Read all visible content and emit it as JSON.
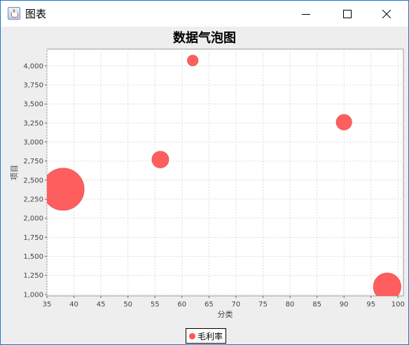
{
  "window": {
    "title": "图表",
    "icon": "java-cup-icon",
    "controls": [
      "minimize-icon",
      "maximize-icon",
      "close-icon"
    ]
  },
  "colors": {
    "bubble": "#ff5555",
    "plot_background": "#ffffff",
    "grid": "#dddddd",
    "frame": "#1979ca"
  },
  "chart_data": {
    "type": "scatter",
    "subtype": "bubble",
    "title": "数据气泡图",
    "xlabel": "分类",
    "ylabel": "项目",
    "xlim": [
      35,
      101
    ],
    "ylim": [
      980,
      4220
    ],
    "x_ticks": [
      35,
      40,
      45,
      50,
      55,
      60,
      65,
      70,
      75,
      80,
      85,
      90,
      95,
      100
    ],
    "y_ticks": [
      1000,
      1250,
      1500,
      1750,
      2000,
      2250,
      2500,
      2750,
      3000,
      3250,
      3500,
      3750,
      4000
    ],
    "x_tick_labels": [
      "35",
      "40",
      "45",
      "50",
      "55",
      "60",
      "65",
      "70",
      "75",
      "80",
      "85",
      "90",
      "95",
      "100"
    ],
    "y_tick_labels": [
      "1,000",
      "1,250",
      "1,500",
      "1,750",
      "2,000",
      "2,250",
      "2,500",
      "2,750",
      "3,000",
      "3,250",
      "3,500",
      "3,750",
      "4,000"
    ],
    "grid": true,
    "legend_position": "bottom",
    "series": [
      {
        "name": "毛利率",
        "color": "#ff5555",
        "points": [
          {
            "x": 38,
            "y": 2380,
            "size": 3.5
          },
          {
            "x": 56,
            "y": 2770,
            "size": 1.4
          },
          {
            "x": 62,
            "y": 4070,
            "size": 0.9
          },
          {
            "x": 90,
            "y": 3260,
            "size": 1.3
          },
          {
            "x": 98,
            "y": 1100,
            "size": 2.3
          }
        ]
      }
    ]
  }
}
